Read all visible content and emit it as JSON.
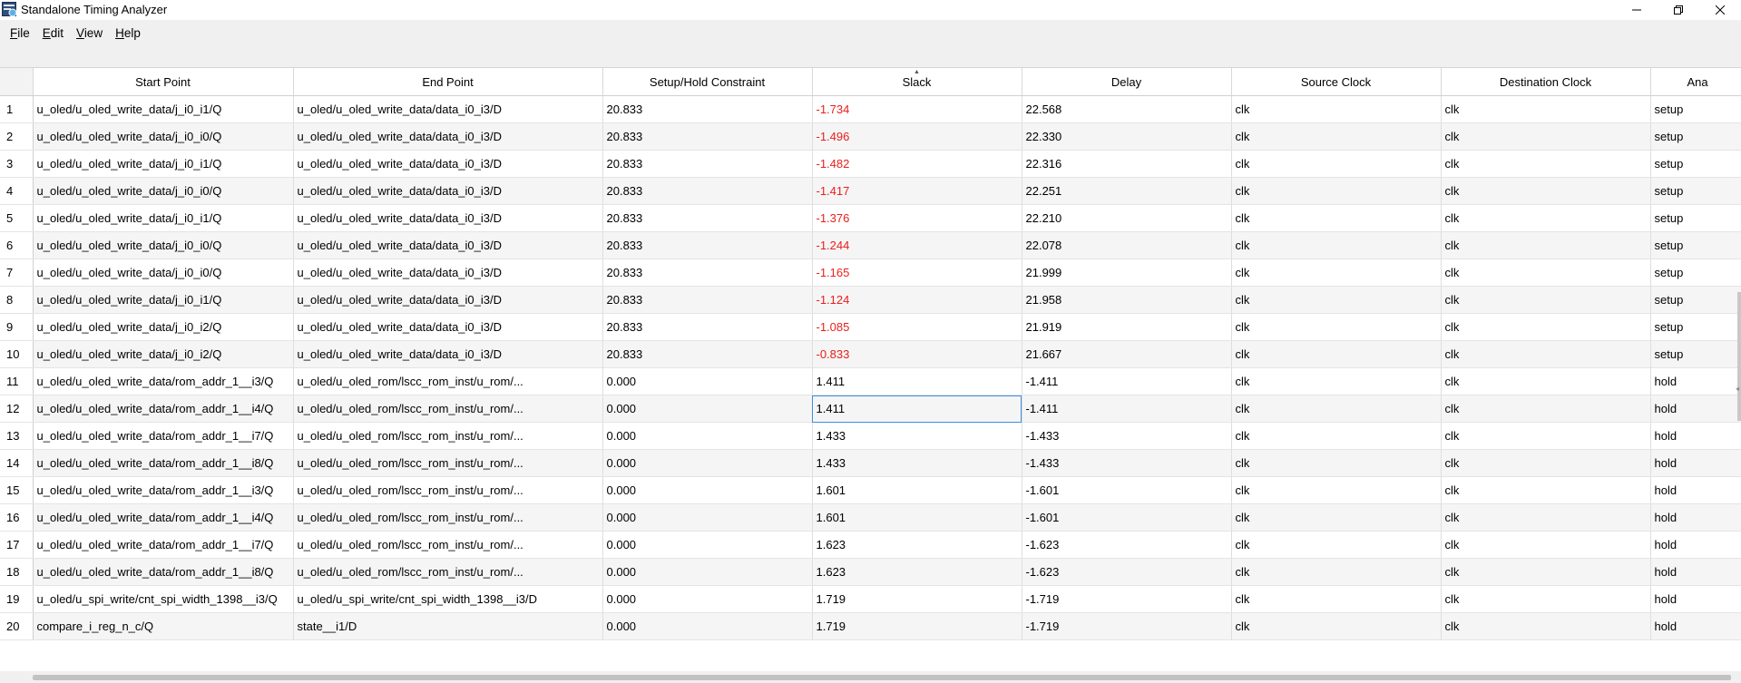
{
  "window": {
    "title": "Standalone Timing Analyzer",
    "buttons": [
      "minimize-icon",
      "restore-icon",
      "close-icon"
    ]
  },
  "menu": [
    {
      "underline": "F",
      "rest": "ile"
    },
    {
      "underline": "E",
      "rest": "dit"
    },
    {
      "underline": "V",
      "rest": "iew"
    },
    {
      "underline": "H",
      "rest": "elp"
    }
  ],
  "table": {
    "columns": [
      "Start Point",
      "End Point",
      "Setup/Hold Constraint",
      "Slack",
      "Delay",
      "Source Clock",
      "Destination Clock",
      "Ana"
    ],
    "sorted_column": "Slack",
    "focused_cell": {
      "row": 12,
      "column": "Slack"
    },
    "rows": [
      {
        "n": "1",
        "start": "u_oled/u_oled_write_data/j_i0_i1/Q",
        "end": "u_oled/u_oled_write_data/data_i0_i3/D",
        "constraint": "20.833",
        "slack": "-1.734",
        "delay": "22.568",
        "src": "clk",
        "dst": "clk",
        "type": "setup"
      },
      {
        "n": "2",
        "start": "u_oled/u_oled_write_data/j_i0_i0/Q",
        "end": "u_oled/u_oled_write_data/data_i0_i3/D",
        "constraint": "20.833",
        "slack": "-1.496",
        "delay": "22.330",
        "src": "clk",
        "dst": "clk",
        "type": "setup"
      },
      {
        "n": "3",
        "start": "u_oled/u_oled_write_data/j_i0_i1/Q",
        "end": "u_oled/u_oled_write_data/data_i0_i3/D",
        "constraint": "20.833",
        "slack": "-1.482",
        "delay": "22.316",
        "src": "clk",
        "dst": "clk",
        "type": "setup"
      },
      {
        "n": "4",
        "start": "u_oled/u_oled_write_data/j_i0_i0/Q",
        "end": "u_oled/u_oled_write_data/data_i0_i3/D",
        "constraint": "20.833",
        "slack": "-1.417",
        "delay": "22.251",
        "src": "clk",
        "dst": "clk",
        "type": "setup"
      },
      {
        "n": "5",
        "start": "u_oled/u_oled_write_data/j_i0_i1/Q",
        "end": "u_oled/u_oled_write_data/data_i0_i3/D",
        "constraint": "20.833",
        "slack": "-1.376",
        "delay": "22.210",
        "src": "clk",
        "dst": "clk",
        "type": "setup"
      },
      {
        "n": "6",
        "start": "u_oled/u_oled_write_data/j_i0_i0/Q",
        "end": "u_oled/u_oled_write_data/data_i0_i3/D",
        "constraint": "20.833",
        "slack": "-1.244",
        "delay": "22.078",
        "src": "clk",
        "dst": "clk",
        "type": "setup"
      },
      {
        "n": "7",
        "start": "u_oled/u_oled_write_data/j_i0_i0/Q",
        "end": "u_oled/u_oled_write_data/data_i0_i3/D",
        "constraint": "20.833",
        "slack": "-1.165",
        "delay": "21.999",
        "src": "clk",
        "dst": "clk",
        "type": "setup"
      },
      {
        "n": "8",
        "start": "u_oled/u_oled_write_data/j_i0_i1/Q",
        "end": "u_oled/u_oled_write_data/data_i0_i3/D",
        "constraint": "20.833",
        "slack": "-1.124",
        "delay": "21.958",
        "src": "clk",
        "dst": "clk",
        "type": "setup"
      },
      {
        "n": "9",
        "start": "u_oled/u_oled_write_data/j_i0_i2/Q",
        "end": "u_oled/u_oled_write_data/data_i0_i3/D",
        "constraint": "20.833",
        "slack": "-1.085",
        "delay": "21.919",
        "src": "clk",
        "dst": "clk",
        "type": "setup"
      },
      {
        "n": "10",
        "start": "u_oled/u_oled_write_data/j_i0_i2/Q",
        "end": "u_oled/u_oled_write_data/data_i0_i3/D",
        "constraint": "20.833",
        "slack": "-0.833",
        "delay": "21.667",
        "src": "clk",
        "dst": "clk",
        "type": "setup"
      },
      {
        "n": "11",
        "start": "u_oled/u_oled_write_data/rom_addr_1__i3/Q",
        "end": "u_oled/u_oled_rom/lscc_rom_inst/u_rom/...",
        "constraint": "0.000",
        "slack": "1.411",
        "delay": "-1.411",
        "src": "clk",
        "dst": "clk",
        "type": "hold"
      },
      {
        "n": "12",
        "start": "u_oled/u_oled_write_data/rom_addr_1__i4/Q",
        "end": "u_oled/u_oled_rom/lscc_rom_inst/u_rom/...",
        "constraint": "0.000",
        "slack": "1.411",
        "delay": "-1.411",
        "src": "clk",
        "dst": "clk",
        "type": "hold"
      },
      {
        "n": "13",
        "start": "u_oled/u_oled_write_data/rom_addr_1__i7/Q",
        "end": "u_oled/u_oled_rom/lscc_rom_inst/u_rom/...",
        "constraint": "0.000",
        "slack": "1.433",
        "delay": "-1.433",
        "src": "clk",
        "dst": "clk",
        "type": "hold"
      },
      {
        "n": "14",
        "start": "u_oled/u_oled_write_data/rom_addr_1__i8/Q",
        "end": "u_oled/u_oled_rom/lscc_rom_inst/u_rom/...",
        "constraint": "0.000",
        "slack": "1.433",
        "delay": "-1.433",
        "src": "clk",
        "dst": "clk",
        "type": "hold"
      },
      {
        "n": "15",
        "start": "u_oled/u_oled_write_data/rom_addr_1__i3/Q",
        "end": "u_oled/u_oled_rom/lscc_rom_inst/u_rom/...",
        "constraint": "0.000",
        "slack": "1.601",
        "delay": "-1.601",
        "src": "clk",
        "dst": "clk",
        "type": "hold"
      },
      {
        "n": "16",
        "start": "u_oled/u_oled_write_data/rom_addr_1__i4/Q",
        "end": "u_oled/u_oled_rom/lscc_rom_inst/u_rom/...",
        "constraint": "0.000",
        "slack": "1.601",
        "delay": "-1.601",
        "src": "clk",
        "dst": "clk",
        "type": "hold"
      },
      {
        "n": "17",
        "start": "u_oled/u_oled_write_data/rom_addr_1__i7/Q",
        "end": "u_oled/u_oled_rom/lscc_rom_inst/u_rom/...",
        "constraint": "0.000",
        "slack": "1.623",
        "delay": "-1.623",
        "src": "clk",
        "dst": "clk",
        "type": "hold"
      },
      {
        "n": "18",
        "start": "u_oled/u_oled_write_data/rom_addr_1__i8/Q",
        "end": "u_oled/u_oled_rom/lscc_rom_inst/u_rom/...",
        "constraint": "0.000",
        "slack": "1.623",
        "delay": "-1.623",
        "src": "clk",
        "dst": "clk",
        "type": "hold"
      },
      {
        "n": "19",
        "start": "u_oled/u_spi_write/cnt_spi_width_1398__i3/Q",
        "end": "u_oled/u_spi_write/cnt_spi_width_1398__i3/D",
        "constraint": "0.000",
        "slack": "1.719",
        "delay": "-1.719",
        "src": "clk",
        "dst": "clk",
        "type": "hold"
      },
      {
        "n": "20",
        "start": "compare_i_reg_n_c/Q",
        "end": "state__i1/D",
        "constraint": "0.000",
        "slack": "1.719",
        "delay": "-1.719",
        "src": "clk",
        "dst": "clk",
        "type": "hold"
      }
    ]
  },
  "colors": {
    "negative_slack": "#e8201c",
    "focus_border": "#3e8de6"
  }
}
